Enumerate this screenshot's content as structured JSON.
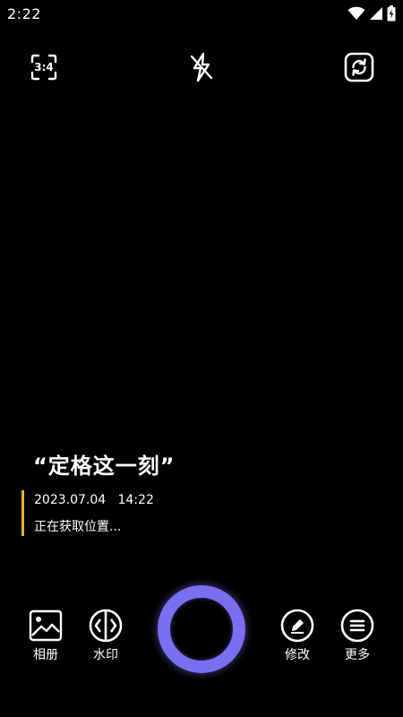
{
  "status_bar": {
    "time": "2:22",
    "icons": [
      "wifi-icon",
      "signal-icon",
      "battery-charging-icon"
    ]
  },
  "top_bar": {
    "aspect_ratio_label": "3:4",
    "flash_icon": "flash-off-icon",
    "switch_camera_icon": "switch-camera-icon"
  },
  "watermark": {
    "slogan": "“定格这一刻”",
    "datetime": "2023.07.04   14:22",
    "location": "正在获取位置...",
    "accent_color": "#f2b233"
  },
  "bottom_bar": {
    "album_label": "相册",
    "watermark_label": "水印",
    "edit_label": "修改",
    "more_label": "更多",
    "shutter_color": "#7a6ff0"
  }
}
